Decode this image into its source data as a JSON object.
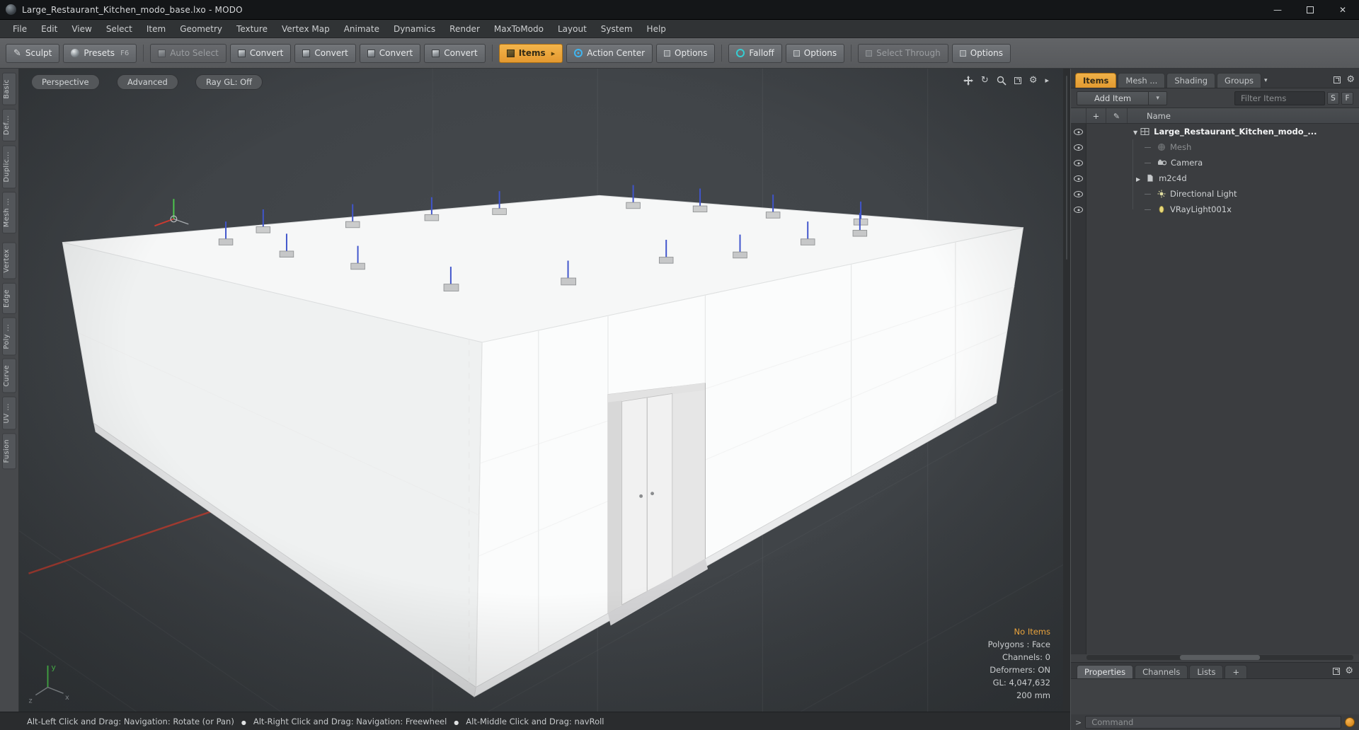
{
  "window": {
    "title": "Large_Restaurant_Kitchen_modo_base.lxo - MODO",
    "controls": {
      "minimize": "—",
      "close": "✕"
    }
  },
  "menu": {
    "items": [
      "File",
      "Edit",
      "View",
      "Select",
      "Item",
      "Geometry",
      "Texture",
      "Vertex Map",
      "Animate",
      "Dynamics",
      "Render",
      "MaxToModo",
      "Layout",
      "System",
      "Help"
    ]
  },
  "toolbar": {
    "buttons": [
      {
        "label": "Sculpt",
        "icon": "brush-icon"
      },
      {
        "label": "Presets",
        "key": "F6",
        "icon": "sphere-icon"
      },
      {
        "label": "Auto Select",
        "icon": "cube-icon",
        "state": "disabled"
      },
      {
        "label": "Convert",
        "icon": "cube-icon"
      },
      {
        "label": "Convert",
        "icon": "cube-icon"
      },
      {
        "label": "Convert",
        "icon": "cube-icon"
      },
      {
        "label": "Convert",
        "icon": "cube-icon"
      },
      {
        "label": "Items",
        "icon": "cube-icon",
        "state": "active"
      },
      {
        "label": "Action Center",
        "icon": "target-icon"
      },
      {
        "label": "Options",
        "icon": "square-icon"
      },
      {
        "label": "Falloff",
        "icon": "ring-icon"
      },
      {
        "label": "Options",
        "icon": "square-icon"
      },
      {
        "label": "Select Through",
        "icon": "square-icon",
        "state": "disabled"
      },
      {
        "label": "Options",
        "icon": "square-icon"
      }
    ]
  },
  "left_tabs": {
    "items": [
      "Basic",
      "Def...",
      "Duplic...",
      "Mesh ...",
      "Vertex",
      "Edge",
      "Poly ...",
      "Curve",
      "UV ...",
      "Fusion"
    ]
  },
  "viewport": {
    "tabs": [
      "Perspective",
      "Advanced",
      "Ray GL: Off"
    ],
    "stats": {
      "no_items": "No Items",
      "polygons": "Polygons : Face",
      "channels": "Channels: 0",
      "deformers": "Deformers: ON",
      "gl": "GL: 4,047,632",
      "scale": "200 mm"
    }
  },
  "right_panel": {
    "tabs": [
      "Items",
      "Mesh ...",
      "Shading",
      "Groups"
    ],
    "add_item_label": "Add Item",
    "filter_label": "Filter Items",
    "s_button": "S",
    "f_button": "F",
    "header": {
      "plus": "+",
      "name": "Name"
    },
    "tree": [
      {
        "label": "Large_Restaurant_Kitchen_modo_...",
        "icon": "scene-icon"
      },
      {
        "label": "Mesh",
        "icon": "mesh-icon",
        "state": "disabled"
      },
      {
        "label": "Camera",
        "icon": "camera-icon"
      },
      {
        "label": "m2c4d",
        "icon": "item-icon"
      },
      {
        "label": "Directional Light",
        "icon": "directional-light-icon"
      },
      {
        "label": "VRayLight001x",
        "icon": "area-light-icon"
      }
    ],
    "bottom_tabs": [
      "Properties",
      "Channels",
      "Lists",
      "+"
    ],
    "command": {
      "prompt": ">",
      "placeholder": "Command"
    }
  },
  "status_bar": {
    "segments": [
      "Alt-Left Click and Drag: Navigation: Rotate (or Pan)",
      "Alt-Right Click and Drag: Navigation: Freewheel",
      "Alt-Middle Click and Drag: navRoll"
    ]
  },
  "colors": {
    "accent_orange": "#e8a33d",
    "light_blue": "#4055cc",
    "falloff_teal": "#35cdd2",
    "action_blue": "#3fb5f0",
    "axis_green": "#4ec94e",
    "axis_red": "#b23c30"
  }
}
